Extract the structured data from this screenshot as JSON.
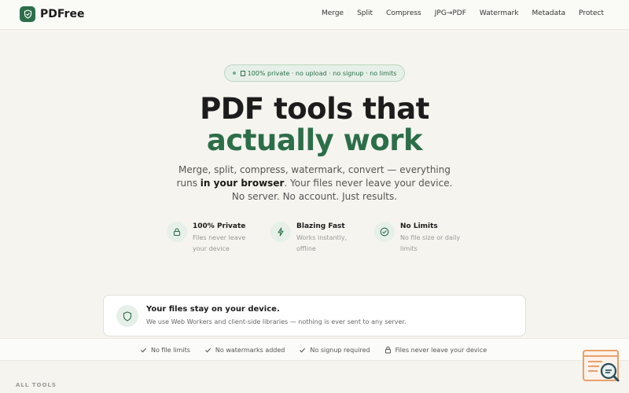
{
  "brand": {
    "name": "PDFree",
    "accent": "#2c6e49"
  },
  "nav": [
    "Merge",
    "Split",
    "Compress",
    "JPG→PDF",
    "Watermark",
    "Metadata",
    "Protect"
  ],
  "hero": {
    "badge": "100% private · no upload · no signup · no limits",
    "title_line1": "PDF tools that",
    "title_line2": "actually work",
    "subtitle_line1": "Merge, split, compress, watermark, convert — everything",
    "subtitle_line2_pre": "runs ",
    "subtitle_line2_bold": "in your browser",
    "subtitle_line2_post": ". Your files never leave your device.",
    "subtitle_line3": "No server. No account. Just results."
  },
  "features": [
    {
      "icon": "lock-icon",
      "title": "100% Private",
      "desc": "Files never leave your device"
    },
    {
      "icon": "lightning-icon",
      "title": "Blazing Fast",
      "desc": "Works instantly, offline"
    },
    {
      "icon": "check-circle-icon",
      "title": "No Limits",
      "desc": "No file size or daily limits"
    }
  ],
  "privacy_card": {
    "title": "Your files stay on your device.",
    "desc": "We use Web Workers and client-side libraries — nothing is ever sent to any server."
  },
  "trust_strip": [
    "No file limits",
    "No watermarks added",
    "No signup required",
    "Files never leave your device"
  ],
  "section_label": "ALL TOOLS"
}
